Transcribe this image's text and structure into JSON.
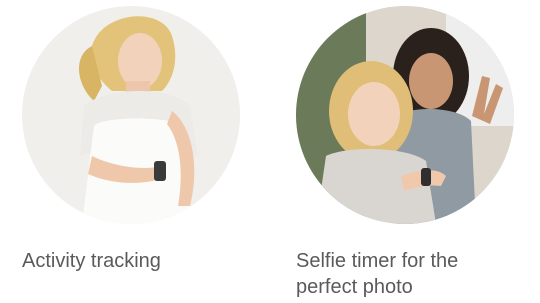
{
  "features": [
    {
      "caption": "Activity tracking",
      "image_subject": "woman-checking-smartwatch"
    },
    {
      "caption": "Selfie timer for the perfect photo",
      "image_subject": "two-women-taking-selfie"
    }
  ]
}
